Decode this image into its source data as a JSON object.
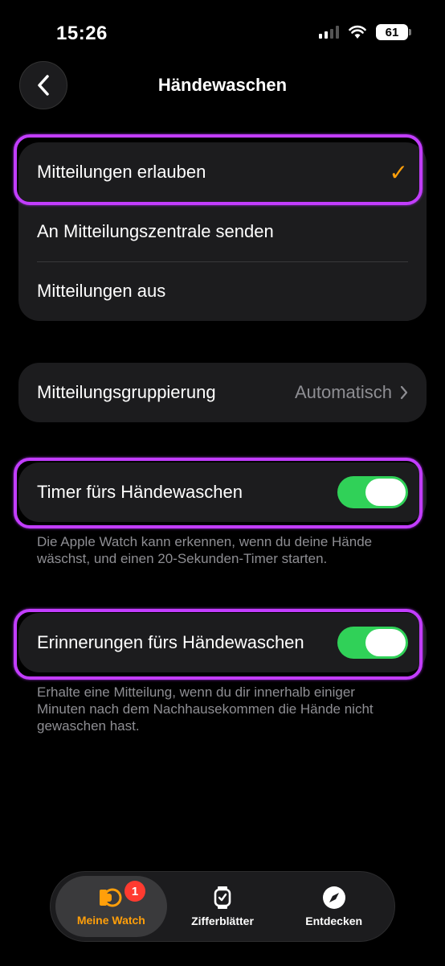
{
  "status": {
    "time": "15:26",
    "battery": "61"
  },
  "header": {
    "title": "Händewaschen"
  },
  "notifications": {
    "options": [
      {
        "label": "Mitteilungen erlauben",
        "selected": true
      },
      {
        "label": "An Mitteilungszentrale senden",
        "selected": false
      },
      {
        "label": "Mitteilungen aus",
        "selected": false
      }
    ]
  },
  "grouping": {
    "label": "Mitteilungsgruppierung",
    "value": "Automatisch"
  },
  "timer": {
    "label": "Timer fürs Händewaschen",
    "enabled": true,
    "footnote": "Die Apple Watch kann erkennen, wenn du deine Hände wäschst, und einen 20-Sekunden-Timer starten."
  },
  "reminders": {
    "label": "Erinnerungen fürs Händewaschen",
    "enabled": true,
    "footnote": "Erhalte eine Mitteilung, wenn du dir innerhalb einiger Minuten nach dem Nachhausekommen die Hände nicht gewaschen hast."
  },
  "tabbar": {
    "items": [
      {
        "label": "Meine Watch",
        "icon": "watch-icon",
        "active": true,
        "badge": "1"
      },
      {
        "label": "Zifferblätter",
        "icon": "watch-face-icon",
        "active": false
      },
      {
        "label": "Entdecken",
        "icon": "compass-icon",
        "active": false
      }
    ]
  },
  "colors": {
    "accent": "#ff9f0a",
    "toggle_on": "#30d158",
    "highlight": "#c23dff",
    "badge": "#ff3b30"
  }
}
